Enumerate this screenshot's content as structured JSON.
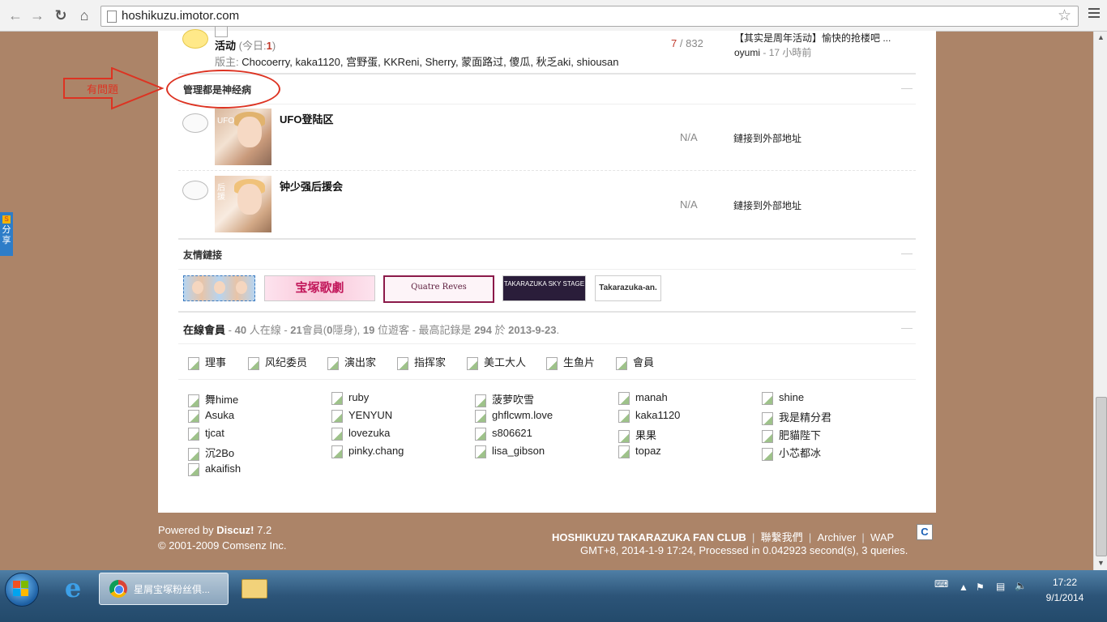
{
  "browser": {
    "url": "hoshikuzu.imotor.com",
    "back_icon": "arrow-left-icon",
    "forward_icon": "arrow-right-icon",
    "reload_icon": "reload-icon",
    "home_icon": "home-icon",
    "star_icon": "star-icon"
  },
  "share": {
    "label_1": "分",
    "label_2": "享"
  },
  "forum_top": {
    "name": "活动",
    "today_prefix": "(今日:",
    "today_count": "1",
    "today_suffix": ")",
    "moderators_label": "版主:",
    "moderators": "Chocoerry, kaka1120, 宫野蛋, KKReni, Sherry, 蒙面路过, 傻瓜, 秋乏aki, shiousan",
    "stats_threads": "7",
    "stats_sep": "/",
    "stats_posts": "832",
    "last_title": "【其实是周年活动】愉快的抢楼吧 ...",
    "last_user": "oyumi",
    "last_time": "- 17 小時前"
  },
  "annotation": {
    "text": "有問題"
  },
  "section_admin": {
    "title": "管理都是神经病",
    "forums": [
      {
        "name": "UFO登陆区",
        "stats": "N/A",
        "last": "鏈接到外部地址",
        "thumb_text": "UFO"
      },
      {
        "name": "钟少强后援会",
        "stats": "N/A",
        "last": "鏈接到外部地址",
        "thumb_text": "后援"
      }
    ]
  },
  "section_links": {
    "title": "友情鏈接",
    "banners": [
      "宝塚歌劇",
      "Quatre Reves",
      "TAKARAZUKA SKY STAGE",
      "Takarazuka-an."
    ]
  },
  "section_online": {
    "title": "在線會員",
    "summary_prefix": "-",
    "total": "40",
    "online_label": "人在線 -",
    "members": "21",
    "members_label": "會員(",
    "hidden": "0",
    "hidden_label": "隱身),",
    "guests": "19",
    "guests_label": "位遊客 - 最高記錄是",
    "record": "294",
    "record_on": "於",
    "record_date": "2013-9-23",
    "record_end": ".",
    "groups": [
      "理事",
      "风纪委员",
      "演出家",
      "指挥家",
      "美工大人",
      "生鱼片",
      "會員"
    ],
    "users": [
      [
        "舞hime",
        "ruby",
        "菠萝吹雪",
        "manah",
        "shine"
      ],
      [
        "Asuka",
        "YENYUN",
        "ghflcwm.love",
        "kaka1120",
        "我是精分君"
      ],
      [
        "tjcat",
        "lovezuka",
        "s806621",
        "果果",
        "肥貓陛下"
      ],
      [
        "沉2Bo",
        "pinky.chang",
        "lisa_gibson",
        "topaz",
        "小芯都冰"
      ],
      [
        "akaifish"
      ]
    ]
  },
  "footer": {
    "powered_prefix": "Powered by",
    "powered_brand": "Discuz!",
    "powered_version": "7.2",
    "copyright": "© 2001-2009 Comsenz Inc.",
    "links": [
      "HOSHIKUZU TAKARAZUKA FAN CLUB",
      "聯繫我們",
      "Archiver",
      "WAP"
    ],
    "status": "GMT+8, 2014-1-9 17:24, Processed in 0.042923 second(s), 3 queries."
  },
  "taskbar": {
    "chrome_label": "星屑宝塚粉丝俱...",
    "time": "17:22",
    "date": "9/1/2014"
  }
}
